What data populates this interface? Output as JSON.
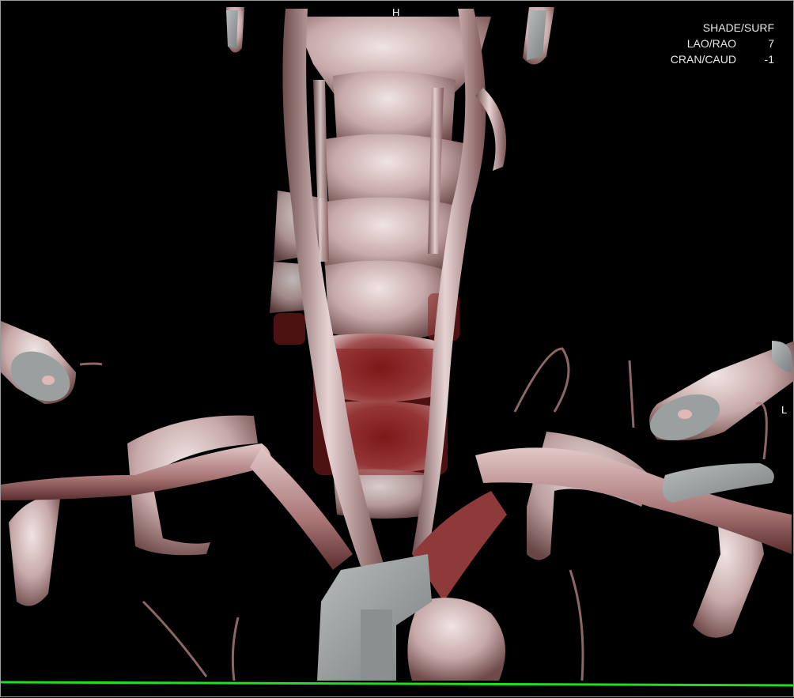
{
  "viewer": {
    "render_mode": "SHADE/SURF",
    "orientation_top": "H",
    "orientation_right": "L",
    "params": [
      {
        "label": "LAO/RAO",
        "value": "7"
      },
      {
        "label": "CRAN/CAUD",
        "value": "-1"
      }
    ],
    "colors": {
      "background": "#000000",
      "bone": "#c9b3b3",
      "vessel": "#b89a9a",
      "tissue_red": "#8a2020",
      "calcium": "#9aa0a0",
      "reference_line": "#22dd22"
    }
  }
}
